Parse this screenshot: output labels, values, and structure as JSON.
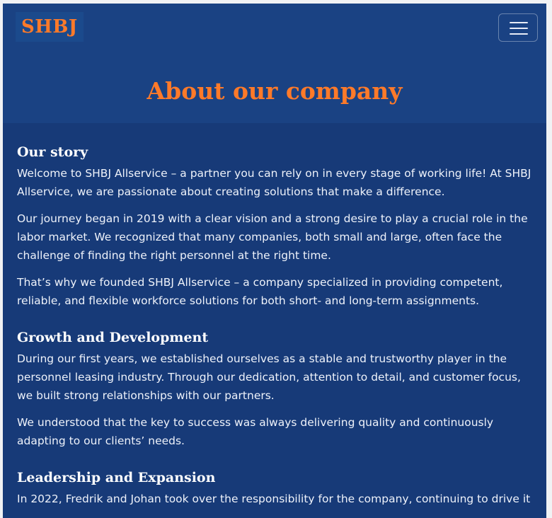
{
  "header": {
    "brand": "SHBJ",
    "menu_icon": "hamburger-menu-icon",
    "title": "About our company"
  },
  "colors": {
    "accent": "#ff7a29",
    "header_bg": "#1a4283",
    "body_bg": "#173a78",
    "text": "#eef2fa"
  },
  "sections": [
    {
      "title": "Our story",
      "paragraphs": [
        "Welcome to SHBJ Allservice – a partner you can rely on in every stage of working life! At SHBJ Allservice, we are passionate about creating solutions that make a difference.",
        "Our journey began in 2019 with a clear vision and a strong desire to play a crucial role in the labor market. We recognized that many companies, both small and large, often face the challenge of finding the right personnel at the right time.",
        "That’s why we founded SHBJ Allservice – a company specialized in providing competent, reliable, and flexible workforce solutions for both short- and long-term assignments."
      ]
    },
    {
      "title": "Growth and Development",
      "paragraphs": [
        "During our first years, we established ourselves as a stable and trustworthy player in the personnel leasing industry. Through our dedication, attention to detail, and customer focus, we built strong relationships with our partners.",
        "We understood that the key to success was always delivering quality and continuously adapting to our clients’ needs."
      ]
    },
    {
      "title": "Leadership and Expansion",
      "paragraphs": [
        "In 2022, Fredrik and Johan took over the responsibility for the company, continuing to drive it"
      ]
    }
  ]
}
